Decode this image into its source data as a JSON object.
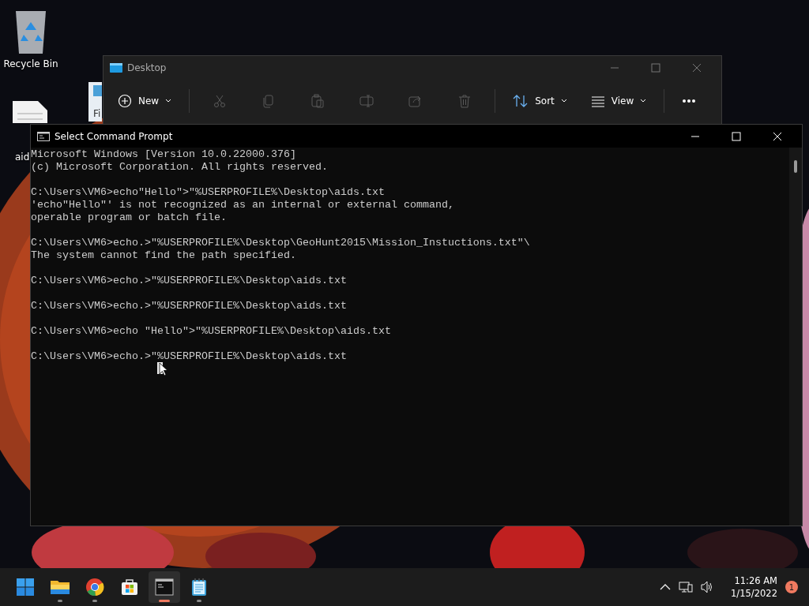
{
  "desktop_icons": [
    {
      "kind": "recycle-bin",
      "label": "Recycle Bin"
    },
    {
      "kind": "text-file",
      "label": "aid"
    },
    {
      "kind": "notepad-file",
      "label": "Fi"
    }
  ],
  "explorer": {
    "title": "Desktop",
    "toolbar": [
      {
        "kind": "new",
        "label": "New",
        "disabled": false
      },
      {
        "kind": "cut",
        "disabled": true
      },
      {
        "kind": "copy",
        "disabled": true
      },
      {
        "kind": "paste",
        "disabled": true
      },
      {
        "kind": "rename",
        "disabled": true
      },
      {
        "kind": "share",
        "disabled": true
      },
      {
        "kind": "delete",
        "disabled": true
      },
      {
        "kind": "sort",
        "label": "Sort",
        "disabled": false
      },
      {
        "kind": "view",
        "label": "View",
        "disabled": false
      },
      {
        "kind": "more",
        "disabled": false
      }
    ]
  },
  "console": {
    "title": "Select Command Prompt",
    "blocks": [
      [
        "Microsoft Windows [Version 10.0.22000.376]",
        "(c) Microsoft Corporation. All rights reserved."
      ],
      [
        "C:\\Users\\VM6>echo\"Hello\">\"%USERPROFILE%\\Desktop\\aids.txt",
        "'echo\"Hello\"' is not recognized as an internal or external command,",
        "operable program or batch file."
      ],
      [
        "C:\\Users\\VM6>echo.>\"%USERPROFILE%\\Desktop\\GeoHunt2015\\Mission_Instuctions.txt\"\\",
        "The system cannot find the path specified."
      ],
      [
        "C:\\Users\\VM6>echo.>\"%USERPROFILE%\\Desktop\\aids.txt"
      ],
      [
        "C:\\Users\\VM6>echo.>\"%USERPROFILE%\\Desktop\\aids.txt"
      ],
      [
        "C:\\Users\\VM6>echo \"Hello\">\"%USERPROFILE%\\Desktop\\aids.txt"
      ],
      [
        "C:\\Users\\VM6>echo.>\"%USERPROFILE%\\Desktop\\aids.txt"
      ]
    ]
  },
  "taskbar": {
    "apps": [
      {
        "kind": "start",
        "running": false,
        "selected": false
      },
      {
        "kind": "folder",
        "running": true,
        "selected": false
      },
      {
        "kind": "browser",
        "running": true,
        "selected": false
      },
      {
        "kind": "store",
        "running": false,
        "selected": false
      },
      {
        "kind": "terminal",
        "running": true,
        "selected": true
      },
      {
        "kind": "notepad",
        "running": true,
        "selected": false
      }
    ],
    "time": "11:26 AM",
    "date": "1/15/2022",
    "notifications": "1"
  }
}
